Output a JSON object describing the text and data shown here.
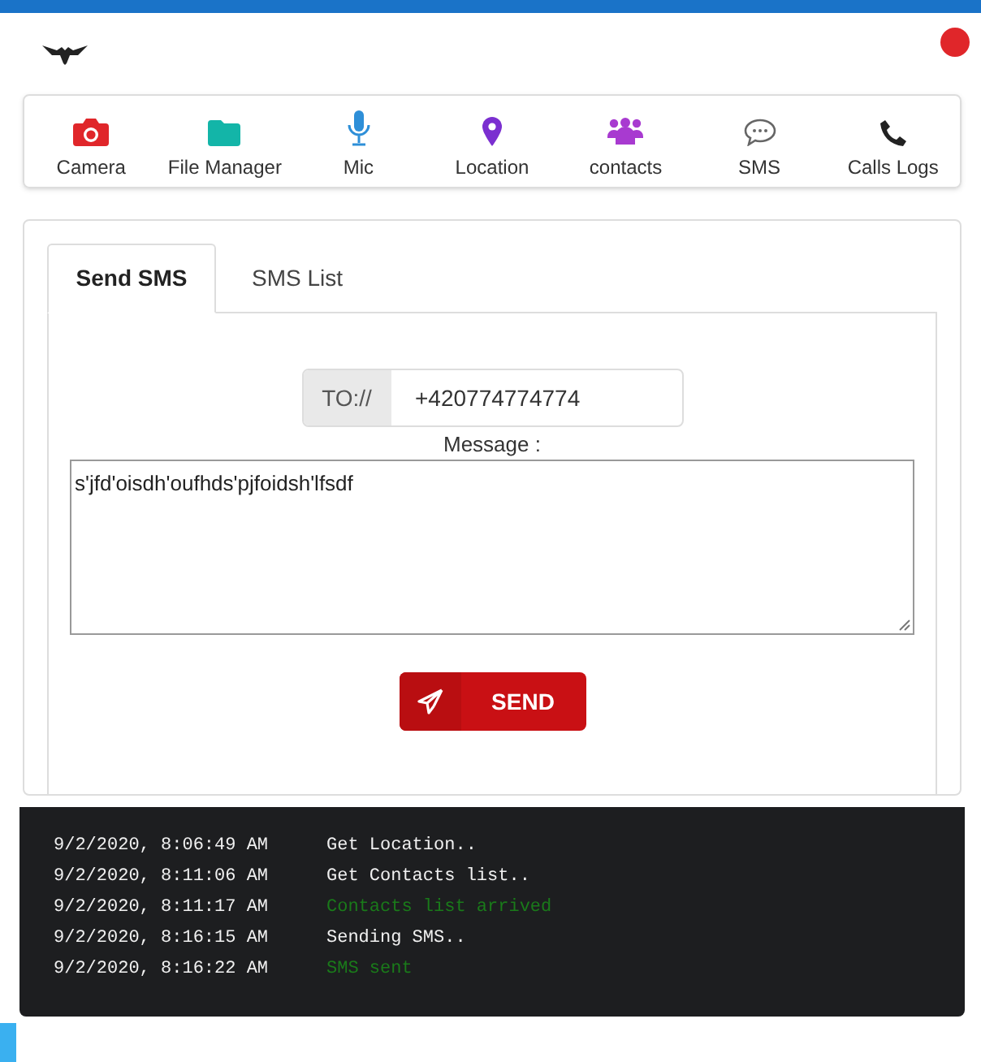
{
  "nav": [
    {
      "label": "Camera"
    },
    {
      "label": "File Manager"
    },
    {
      "label": "Mic"
    },
    {
      "label": "Location"
    },
    {
      "label": "contacts"
    },
    {
      "label": "SMS"
    },
    {
      "label": "Calls Logs"
    }
  ],
  "tabs": [
    {
      "label": "Send SMS",
      "selected": true
    },
    {
      "label": "SMS List",
      "selected": false
    }
  ],
  "to": {
    "prefix": "TO://",
    "value": "+420774774774"
  },
  "message": {
    "label": "Message :",
    "value": "s'jfd'oisdh'oufhds'pjfoidsh'lfsdf"
  },
  "send_button": "SEND",
  "log": [
    {
      "time": "9/2/2020, 8:06:49 AM",
      "text": "Get Location..",
      "kind": "info"
    },
    {
      "time": "9/2/2020, 8:11:06 AM",
      "text": "Get Contacts list..",
      "kind": "info"
    },
    {
      "time": "9/2/2020, 8:11:17 AM",
      "text": "Contacts list arrived",
      "kind": "success"
    },
    {
      "time": "9/2/2020, 8:16:15 AM",
      "text": "Sending SMS..",
      "kind": "info"
    },
    {
      "time": "9/2/2020, 8:16:22 AM",
      "text": "SMS sent",
      "kind": "success"
    }
  ]
}
